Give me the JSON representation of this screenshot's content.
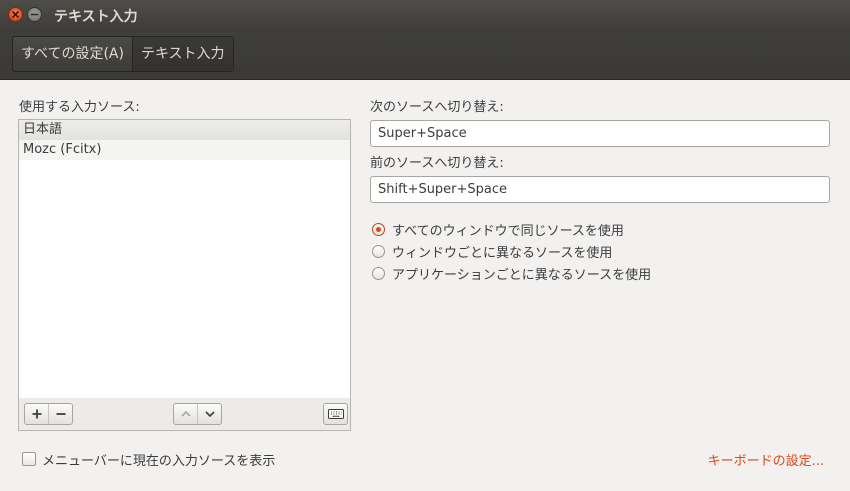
{
  "window": {
    "title": "テキスト入力"
  },
  "breadcrumb": [
    {
      "label": "すべての設定(A)"
    },
    {
      "label": "テキスト入力"
    }
  ],
  "sources": {
    "label": "使用する入力ソース:",
    "items": [
      "日本語",
      "Mozc (Fcitx)"
    ],
    "selected_index": 0
  },
  "list_toolbar": {
    "add": "+",
    "remove": "−",
    "up": "⌃",
    "down": "⌄",
    "keyboard_icon": "keyboard-icon"
  },
  "shortcuts": {
    "next_label": "次のソースへ切り替え:",
    "next_value": "Super+Space",
    "prev_label": "前のソースへ切り替え:",
    "prev_value": "Shift+Super+Space"
  },
  "mode": {
    "options": [
      "すべてのウィンドウで同じソースを使用",
      "ウィンドウごとに異なるソースを使用",
      "アプリケーションごとに異なるソースを使用"
    ],
    "selected_index": 0
  },
  "footer": {
    "show_menu_label": "メニューバーに現在の入力ソースを表示",
    "show_menu_checked": false,
    "keyboard_settings_link": "キーボードの設定..."
  },
  "colors": {
    "accent": "#dd4814",
    "titlebar": "#3c3b37",
    "background": "#f2f1f0"
  }
}
